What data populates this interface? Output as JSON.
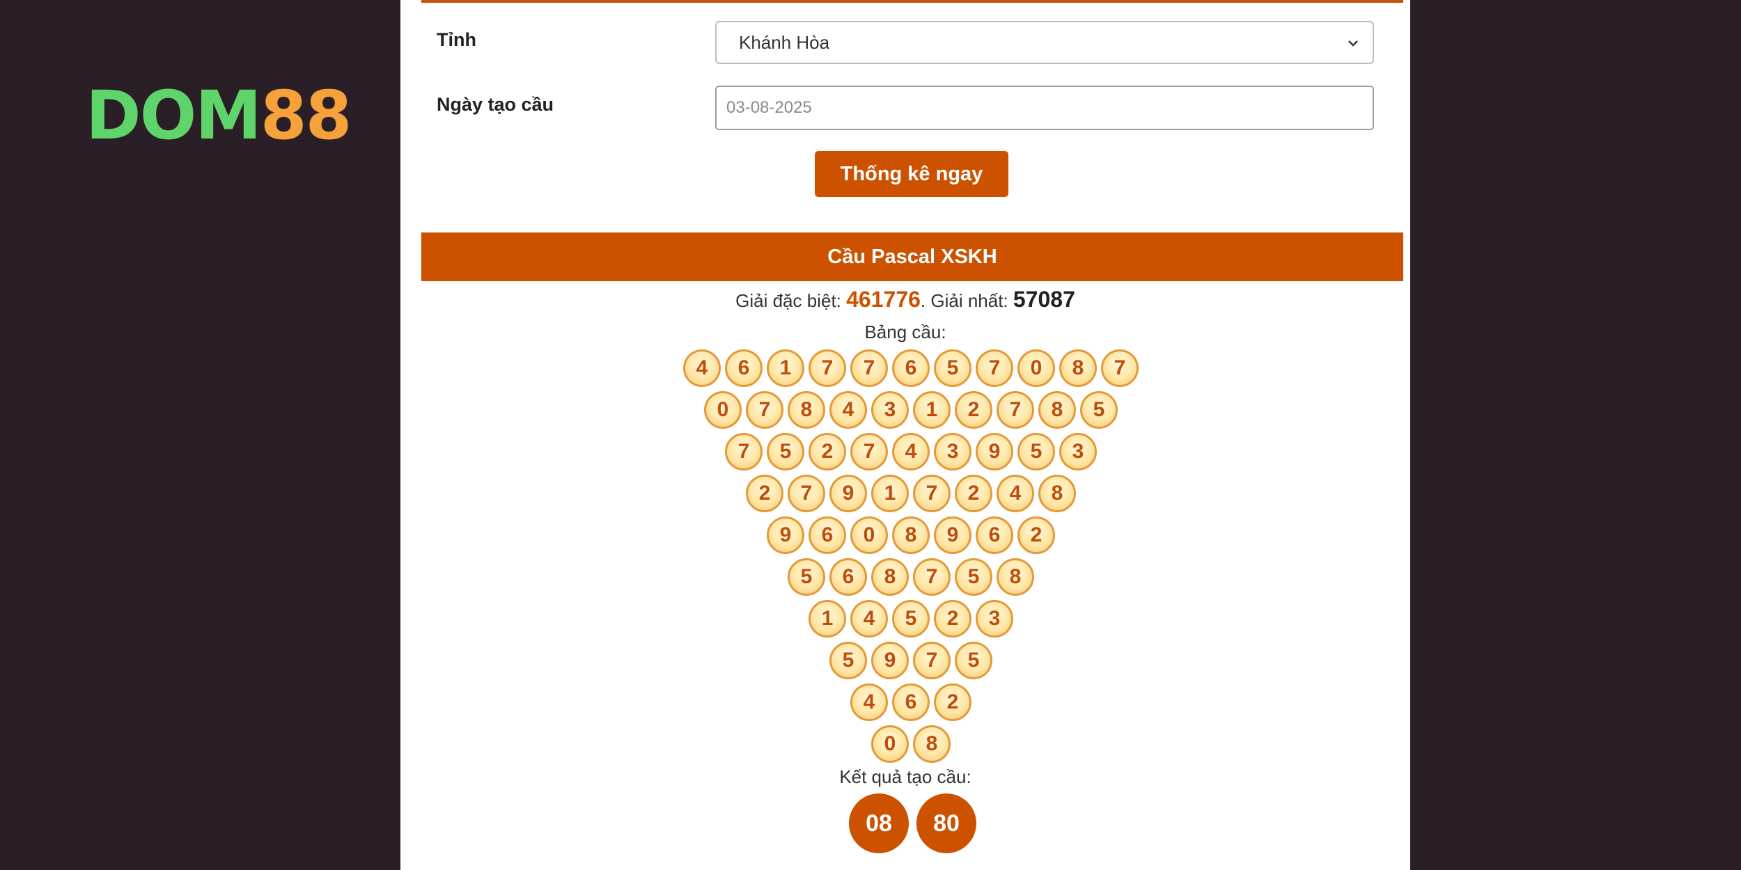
{
  "logo": {
    "part1": "DOM",
    "part2": "88"
  },
  "form": {
    "province_label": "Tỉnh",
    "province_value": "Khánh Hòa",
    "date_label": "Ngày tạo cầu",
    "date_placeholder": "03-08-2025",
    "submit_label": "Thống kê ngay"
  },
  "section": {
    "title": "Cầu Pascal XSKH"
  },
  "prizes": {
    "special_label": "Giải đặc biệt:",
    "special_value": "461776",
    "first_label": ". Giải nhất:",
    "first_value": "57087"
  },
  "table": {
    "label": "Bảng cầu:",
    "rows": [
      [
        4,
        6,
        1,
        7,
        7,
        6,
        5,
        7,
        0,
        8,
        7
      ],
      [
        0,
        7,
        8,
        4,
        3,
        1,
        2,
        7,
        8,
        5
      ],
      [
        7,
        5,
        2,
        7,
        4,
        3,
        9,
        5,
        3
      ],
      [
        2,
        7,
        9,
        1,
        7,
        2,
        4,
        8
      ],
      [
        9,
        6,
        0,
        8,
        9,
        6,
        2
      ],
      [
        5,
        6,
        8,
        7,
        5,
        8
      ],
      [
        1,
        4,
        5,
        2,
        3
      ],
      [
        5,
        9,
        7,
        5
      ],
      [
        4,
        6,
        2
      ],
      [
        0,
        8
      ]
    ]
  },
  "result": {
    "label": "Kết quả tạo cầu:",
    "values": [
      "08",
      "80"
    ]
  },
  "colors": {
    "brand_orange": "#cc5200",
    "background": "#2a1e27",
    "logo_green": "#5fd46a",
    "logo_orange": "#f6a13a"
  }
}
